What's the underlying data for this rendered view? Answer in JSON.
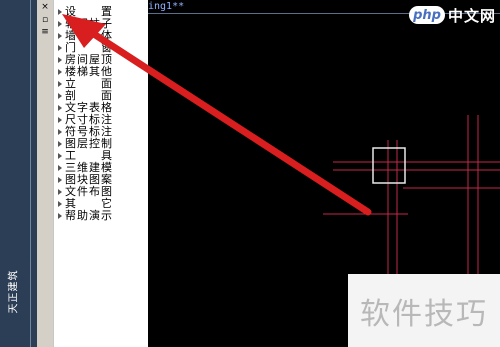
{
  "app": {
    "side_tab_label": "天正建筑",
    "drawing_tab": "ing1**"
  },
  "toolbar": {
    "close_glyph": "×",
    "pin_glyph": "▫",
    "menu_glyph": "≡"
  },
  "menu": {
    "items": [
      {
        "label": "设　　置"
      },
      {
        "label": "轴网柱子"
      },
      {
        "label": "墙　　体"
      },
      {
        "label": "门　　窗"
      },
      {
        "label": "房间屋顶"
      },
      {
        "label": "楼梯其他"
      },
      {
        "label": "立　　面"
      },
      {
        "label": "剖　　面"
      },
      {
        "label": "文字表格"
      },
      {
        "label": "尺寸标注"
      },
      {
        "label": "符号标注"
      },
      {
        "label": "图层控制"
      },
      {
        "label": "工　　具"
      },
      {
        "label": "三维建模"
      },
      {
        "label": "图块图案"
      },
      {
        "label": "文件布图"
      },
      {
        "label": "其　　它"
      },
      {
        "label": "帮助演示"
      }
    ]
  },
  "branding": {
    "logo_badge": "php",
    "logo_text": "中文网",
    "watermark_text": "软件技巧"
  },
  "colors": {
    "panel_bg": "#ffffff",
    "strip_bg": "#2c3e55",
    "canvas_bg": "#000000",
    "grid_red": "#c0294a",
    "arrow_red": "#d81e1e"
  }
}
